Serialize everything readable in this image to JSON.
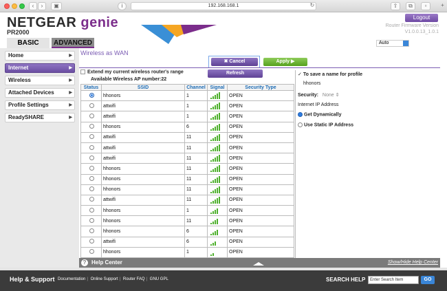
{
  "browser": {
    "url": "192.168.168.1"
  },
  "header": {
    "brand": "NETGEAR",
    "genie": "genie",
    "model": "PR2000",
    "logout_label": "Logout",
    "fw_label": "Router Firmware Version",
    "fw_version": "V1.0.0.13_1.0.1",
    "tabs": [
      {
        "label": "BASIC"
      },
      {
        "label": "ADVANCED"
      }
    ],
    "language": "Auto"
  },
  "sidebar": {
    "items": [
      {
        "label": "Home"
      },
      {
        "label": "Internet",
        "active": true
      },
      {
        "label": "Wireless"
      },
      {
        "label": "Attached Devices"
      },
      {
        "label": "Profile Settings"
      },
      {
        "label": "ReadySHARE"
      }
    ]
  },
  "main": {
    "title": "Wireless as WAN",
    "cancel_label": "Cancel",
    "apply_label": "Apply",
    "refresh_label": "Refresh",
    "extend_label": "Extend my current wireless router's range",
    "ap_count_label": "Available Wireless AP number:22",
    "columns": [
      "Status",
      "SSID",
      "Channel",
      "Signal",
      "Security Type"
    ],
    "rows": [
      {
        "ssid": "hhonors",
        "channel": "1",
        "signal": 4,
        "security": "OPEN",
        "selected": true
      },
      {
        "ssid": "attwifi",
        "channel": "1",
        "signal": 4,
        "security": "OPEN"
      },
      {
        "ssid": "attwifi",
        "channel": "1",
        "signal": 4,
        "security": "OPEN"
      },
      {
        "ssid": "hhonors",
        "channel": "6",
        "signal": 4,
        "security": "OPEN"
      },
      {
        "ssid": "attwifi",
        "channel": "11",
        "signal": 4,
        "security": "OPEN"
      },
      {
        "ssid": "attwifi",
        "channel": "11",
        "signal": 4,
        "security": "OPEN"
      },
      {
        "ssid": "attwifi",
        "channel": "11",
        "signal": 4,
        "security": "OPEN"
      },
      {
        "ssid": "hhonors",
        "channel": "11",
        "signal": 4,
        "security": "OPEN"
      },
      {
        "ssid": "hhonors",
        "channel": "11",
        "signal": 4,
        "security": "OPEN"
      },
      {
        "ssid": "hhonors",
        "channel": "11",
        "signal": 4,
        "security": "OPEN"
      },
      {
        "ssid": "attwifi",
        "channel": "11",
        "signal": 4,
        "security": "OPEN"
      },
      {
        "ssid": "hhonors",
        "channel": "1",
        "signal": 3,
        "security": "OPEN"
      },
      {
        "ssid": "hhonors",
        "channel": "11",
        "signal": 3,
        "security": "OPEN"
      },
      {
        "ssid": "hhonors",
        "channel": "6",
        "signal": 3,
        "security": "OPEN"
      },
      {
        "ssid": "attwifi",
        "channel": "6",
        "signal": 2,
        "security": "OPEN"
      },
      {
        "ssid": "hhonors",
        "channel": "1",
        "signal": 1,
        "security": "OPEN"
      }
    ]
  },
  "profile": {
    "save_name_label": "To save a name for profile",
    "profile_name": "hhonors",
    "security_label": "Security:",
    "security_value": "None",
    "ip_heading": "Internet IP Address",
    "dynamic_label": "Get Dynamically",
    "static_label": "Use Static IP Address"
  },
  "help": {
    "title": "Help Center",
    "toggle_label": "Show/Hide Help Center"
  },
  "footer": {
    "help_support": "Help & Support",
    "links": [
      "Documentation",
      "Online Support",
      "Router FAQ",
      "GNU GPL"
    ],
    "search_label": "SEARCH HELP",
    "search_placeholder": "Enter Search Item",
    "go_label": "GO"
  },
  "colors": {
    "accent": "#7b2d8b",
    "apply": "#56a11e",
    "signal": "#4caf2a"
  }
}
